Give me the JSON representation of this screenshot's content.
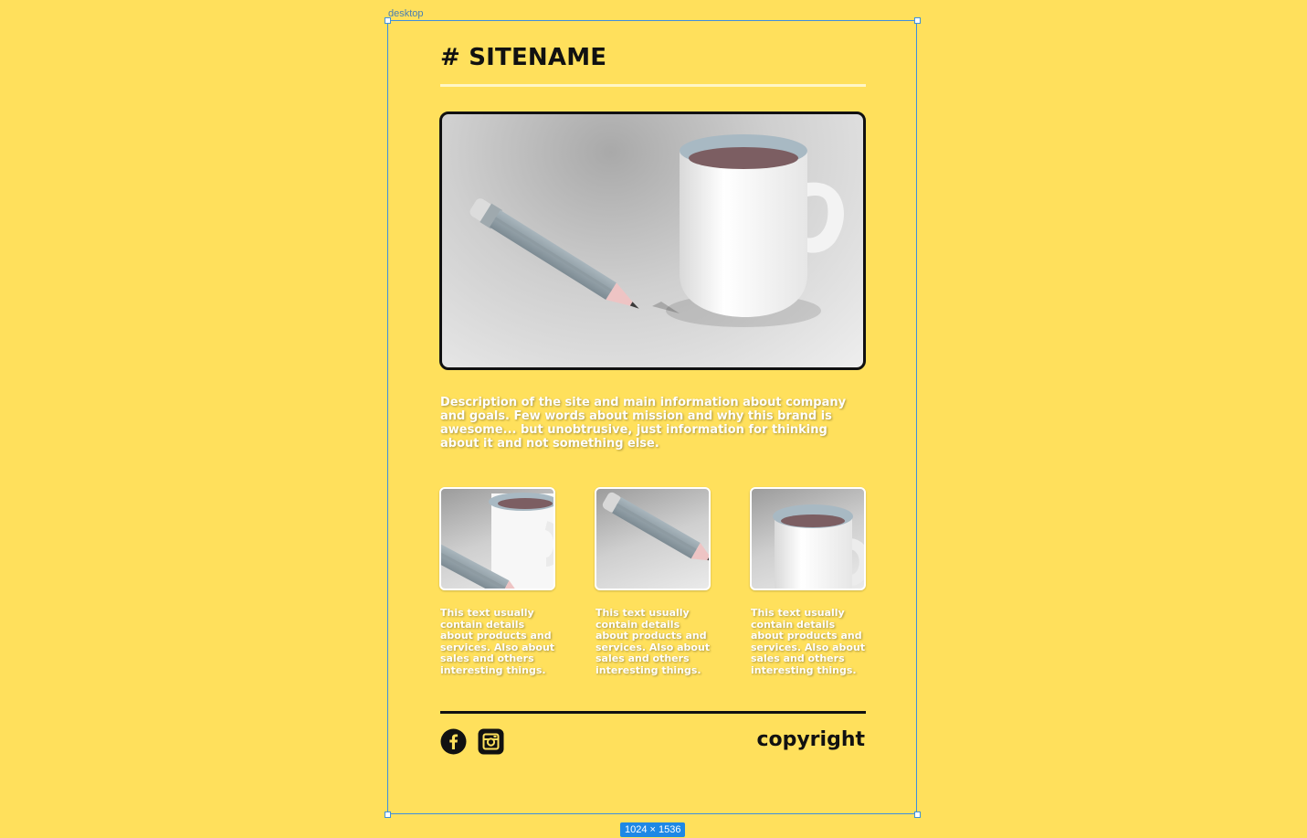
{
  "canvas": {
    "frame_label": "desktop",
    "size_badge": "1024 × 1536"
  },
  "header": {
    "sitename": "# SITENAME"
  },
  "hero": {
    "image_subject": "pencil and coffee mug 3D render"
  },
  "description": "Description of the site and main information about company and goals. Few words about mission and why this brand is awesome... but unobtrusive, just information for thinking about it and not something else.",
  "cards": [
    {
      "image_subject": "mug and pencil",
      "text": "This text usually contain details about products and services. Also about sales and others interesting things."
    },
    {
      "image_subject": "pencil",
      "text": "This text usually contain details about products and services. Also about sales and others interesting things."
    },
    {
      "image_subject": "mug",
      "text": "This text usually contain details about products and services. Also about sales and others interesting things."
    }
  ],
  "footer": {
    "social": [
      {
        "icon": "facebook-icon"
      },
      {
        "icon": "instagram-icon"
      }
    ],
    "copyright": "copyright"
  },
  "colors": {
    "background": "#FFE05C",
    "text_dark": "#111111",
    "text_light": "#FFFFFF",
    "selection": "#3D8FDF"
  }
}
